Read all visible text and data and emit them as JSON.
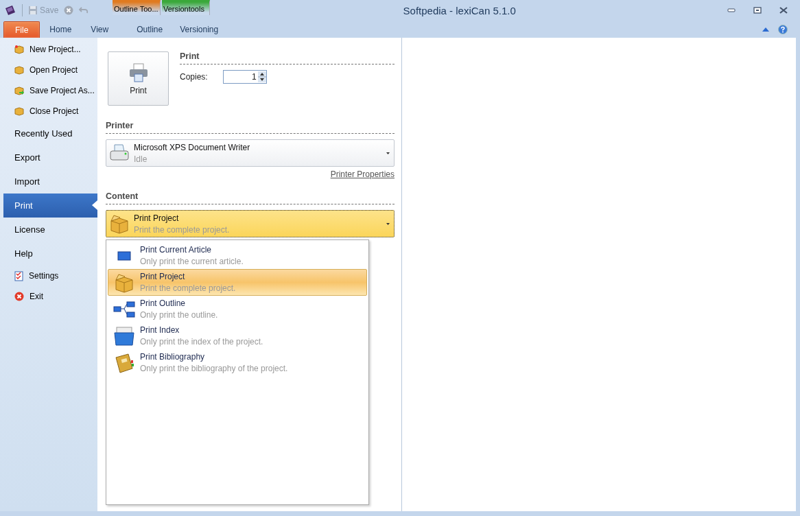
{
  "window": {
    "title": "Softpedia - lexiCan 5.1.0"
  },
  "quick_access": {
    "save": "Save"
  },
  "context_groups": [
    {
      "label": "Outline Too...",
      "color": "#e07a1f"
    },
    {
      "label": "Versiontools",
      "color": "#3aa83a"
    }
  ],
  "tabs": [
    {
      "label": "File",
      "kind": "file",
      "selected": true
    },
    {
      "label": "Home",
      "kind": "tab",
      "selected": false
    },
    {
      "label": "View",
      "kind": "tab",
      "selected": false
    },
    {
      "label": "Outline",
      "kind": "contextual",
      "selected": false
    },
    {
      "label": "Versioning",
      "kind": "contextual",
      "selected": false
    }
  ],
  "sidebar": {
    "items": [
      {
        "label": "New Project...",
        "kind": "box-new",
        "selected": false
      },
      {
        "label": "Open Project",
        "kind": "box",
        "selected": false
      },
      {
        "label": "Save Project As...",
        "kind": "box-save",
        "selected": false
      },
      {
        "label": "Close Project",
        "kind": "box",
        "selected": false
      },
      {
        "label": "Recently Used",
        "kind": "section",
        "selected": false
      },
      {
        "label": "Export",
        "kind": "section",
        "selected": false
      },
      {
        "label": "Import",
        "kind": "section",
        "selected": false
      },
      {
        "label": "Print",
        "kind": "section",
        "selected": true
      },
      {
        "label": "License",
        "kind": "section",
        "selected": false
      },
      {
        "label": "Help",
        "kind": "section",
        "selected": false
      },
      {
        "label": "Settings",
        "kind": "checklist",
        "selected": false
      },
      {
        "label": "Exit",
        "kind": "exit",
        "selected": false
      }
    ]
  },
  "print": {
    "button": "Print",
    "heading": "Print",
    "copies_label": "Copies:",
    "copies": "1"
  },
  "printer": {
    "heading": "Printer",
    "name": "Microsoft XPS Document Writer",
    "status": "Idle",
    "properties_link": "Printer Properties"
  },
  "content": {
    "heading": "Content",
    "current": {
      "title": "Print Project",
      "description": "Print the complete project.",
      "kind": "project"
    },
    "options": [
      {
        "title": "Print Current Article",
        "description": "Only print the current article.",
        "kind": "article",
        "selected": false
      },
      {
        "title": "Print Project",
        "description": "Print the complete project.",
        "kind": "project",
        "selected": true
      },
      {
        "title": "Print Outline",
        "description": "Only print the outline.",
        "kind": "outline",
        "selected": false
      },
      {
        "title": "Print Index",
        "description": "Only print the index of the project.",
        "kind": "index",
        "selected": false
      },
      {
        "title": "Print Bibliography",
        "description": "Only print the bibliography of the project.",
        "kind": "bibliography",
        "selected": false
      }
    ]
  }
}
